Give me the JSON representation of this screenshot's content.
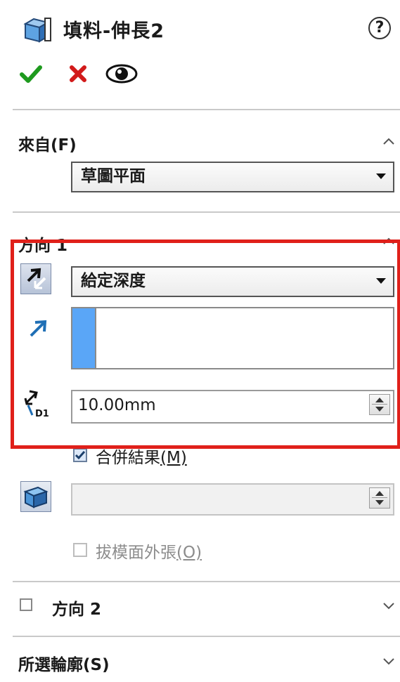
{
  "header": {
    "title": "填料-伸長2",
    "help_symbol": "?"
  },
  "actions": {
    "ok": "confirm-checkmark",
    "cancel": "cancel-x",
    "preview": "preview-eye"
  },
  "from": {
    "label": "來自(F)",
    "start_condition": "草圖平面"
  },
  "direction1": {
    "label": "方向 1",
    "end_condition": "給定深度",
    "depth_value": "10.00mm",
    "depth_symbol": "D1",
    "merge_result_label": "合併結果",
    "merge_result_key": "(M)",
    "merge_result_checked": true,
    "draft_label": "拔模面外張",
    "draft_key": "(O)",
    "draft_checked": false
  },
  "direction2": {
    "label": "方向 2",
    "checked": false
  },
  "selected_contours": {
    "label": "所選輪廓(S)"
  },
  "colors": {
    "highlight": "#e0201a",
    "ok": "#1e9a1e",
    "cancel": "#d21a1a",
    "accent": "#5aa6f7"
  }
}
